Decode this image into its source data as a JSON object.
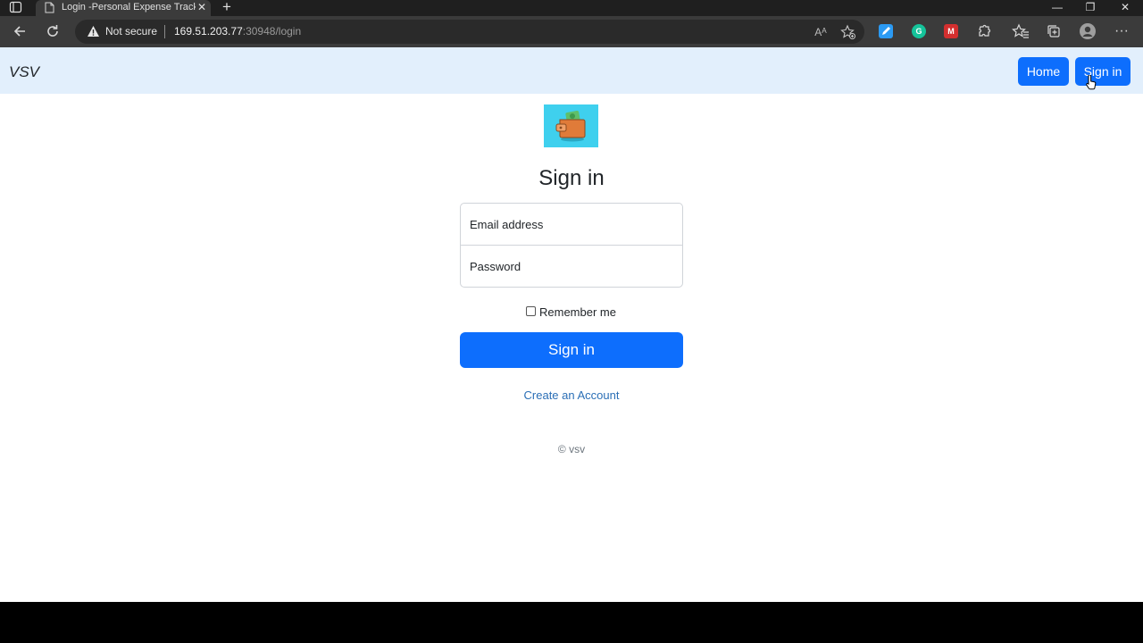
{
  "browser": {
    "tab_title": "Login -Personal Expense Tracker",
    "tab_close": "✕",
    "new_tab": "+",
    "minimize": "—",
    "restore": "❐",
    "close": "✕",
    "security_label": "Not secure",
    "url_host": "169.51.203.77",
    "url_rest": ":30948/login",
    "read_aloud": "Aᴬ",
    "more": "···"
  },
  "navbar": {
    "brand": "VSV",
    "home_label": "Home",
    "signin_label": "Sign in"
  },
  "form": {
    "heading": "Sign in",
    "email_label": "Email address",
    "password_label": "Password",
    "remember_label": "Remember me",
    "submit_label": "Sign in",
    "create_account_label": "Create an Account"
  },
  "footer": {
    "text": "© vsv"
  },
  "colors": {
    "primary": "#0d6efd",
    "navbar_bg": "#e2effc",
    "logo_bg": "#3fd0ee",
    "link": "#2b6fb6"
  }
}
